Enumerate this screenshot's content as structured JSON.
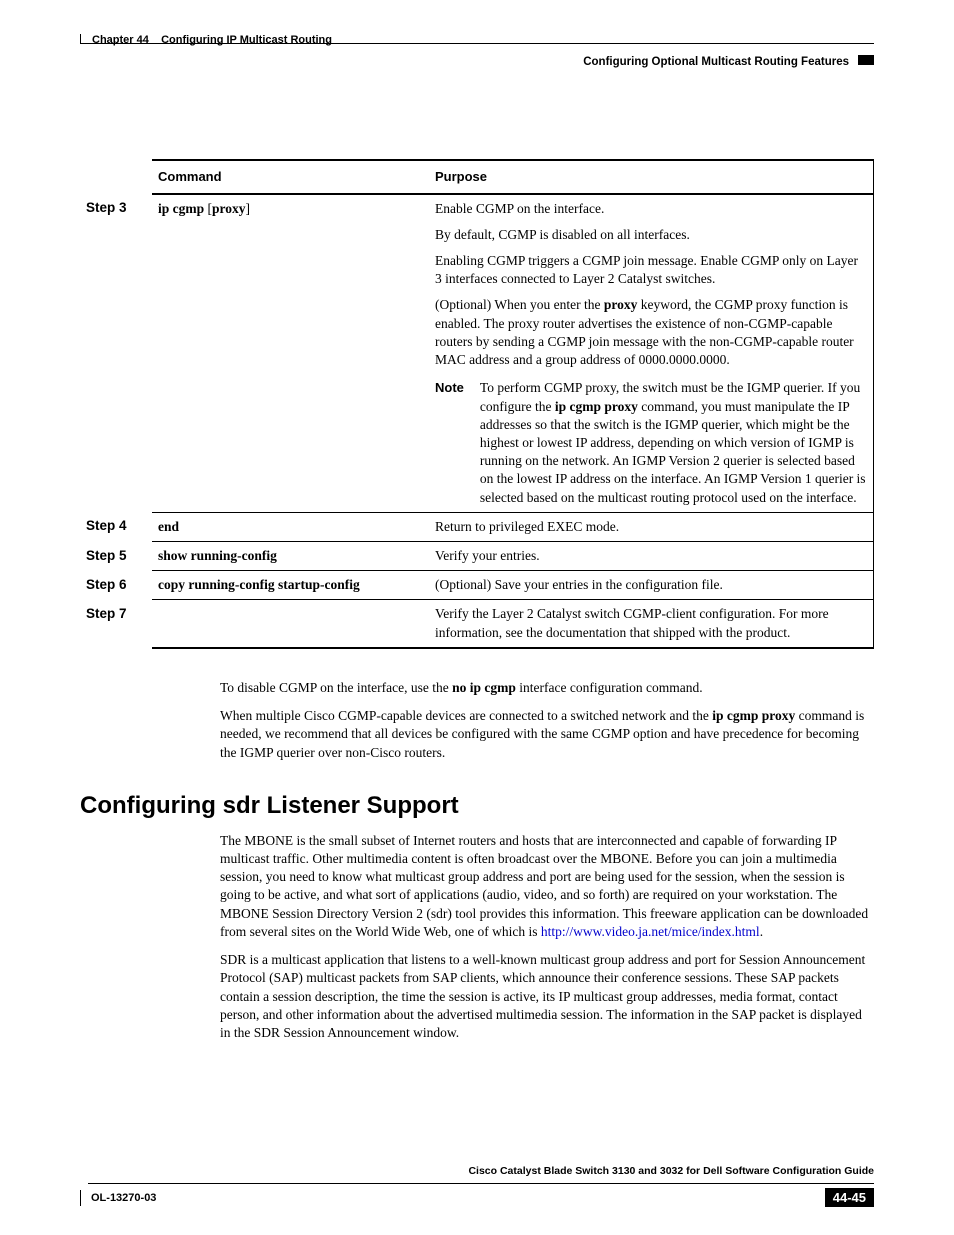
{
  "header": {
    "crumb_chapter": "Chapter 44",
    "crumb_title": "Configuring IP Multicast Routing",
    "subhead": "Configuring Optional Multicast Routing Features"
  },
  "table": {
    "headers": {
      "command": "Command",
      "purpose": "Purpose"
    },
    "rows": {
      "r3": {
        "step": "Step 3",
        "cmd_a": "ip cgmp",
        "cmd_b": "[",
        "cmd_c": "proxy",
        "cmd_d": "]",
        "p1": "Enable CGMP on the interface.",
        "p2": "By default, CGMP is disabled on all interfaces.",
        "p3": "Enabling CGMP triggers a CGMP join message. Enable CGMP only on Layer 3 interfaces connected to Layer 2 Catalyst switches.",
        "p4a": "(Optional) When you enter the ",
        "p4b": "proxy",
        "p4c": " keyword, the CGMP proxy function is enabled. The proxy router advertises the existence of non-CGMP-capable routers by sending a CGMP join message with the non-CGMP-capable router MAC address and a group address of 0000.0000.0000.",
        "note_label": "Note",
        "note_a": "To perform CGMP proxy, the switch must be the IGMP querier. If you configure the ",
        "note_b": "ip cgmp proxy",
        "note_c": " command, you must manipulate the IP addresses so that the switch is the IGMP querier, which might be the highest or lowest IP address, depending on which version of IGMP is running on the network. An IGMP Version 2 querier is selected based on the lowest IP address on the interface. An IGMP Version 1 querier is selected based on the multicast routing protocol used on the interface."
      },
      "r4": {
        "step": "Step 4",
        "cmd": "end",
        "purp": "Return to privileged EXEC mode."
      },
      "r5": {
        "step": "Step 5",
        "cmd": "show running-config",
        "purp": "Verify your entries."
      },
      "r6": {
        "step": "Step 6",
        "cmd": "copy running-config startup-config",
        "purp": "(Optional) Save your entries in the configuration file."
      },
      "r7": {
        "step": "Step 7",
        "cmd": "",
        "purp": "Verify the Layer 2 Catalyst switch CGMP-client configuration. For more information, see the documentation that shipped with the product."
      }
    }
  },
  "body": {
    "p1a": "To disable CGMP on the interface, use the ",
    "p1b": "no ip cgmp",
    "p1c": " interface configuration command.",
    "p2a": "When multiple Cisco CGMP-capable devices are connected to a switched network and the ",
    "p2b": "ip cgmp proxy",
    "p2c": " command is needed, we recommend that all devices be configured with the same CGMP option and have precedence for becoming the IGMP querier over non-Cisco routers.",
    "h2": "Configuring sdr Listener Support",
    "p3a": "The MBONE is the small subset of Internet routers and hosts that are interconnected and capable of forwarding IP multicast traffic. Other multimedia content is often broadcast over the MBONE. Before you can join a multimedia session, you need to know what multicast group address and port are being used for the session, when the session is going to be active, and what sort of applications (audio, video, and so forth) are required on your workstation. The MBONE Session Directory Version 2 (sdr) tool provides this information. This freeware application can be downloaded from several sites on the World Wide Web, one of which is ",
    "p3b": "http://www.video.ja.net/mice/index.html",
    "p3c": ".",
    "p4": "SDR is a multicast application that listens to a well-known multicast group address and port for Session Announcement Protocol (SAP) multicast packets from SAP clients, which announce their conference sessions. These SAP packets contain a session description, the time the session is active, its IP multicast group addresses, media format, contact person, and other information about the advertised multimedia session. The information in the SAP packet is displayed in the SDR Session Announcement window."
  },
  "footer": {
    "title": "Cisco Catalyst Blade Switch 3130 and 3032 for Dell Software Configuration Guide",
    "doc": "OL-13270-03",
    "page": "44-45"
  }
}
